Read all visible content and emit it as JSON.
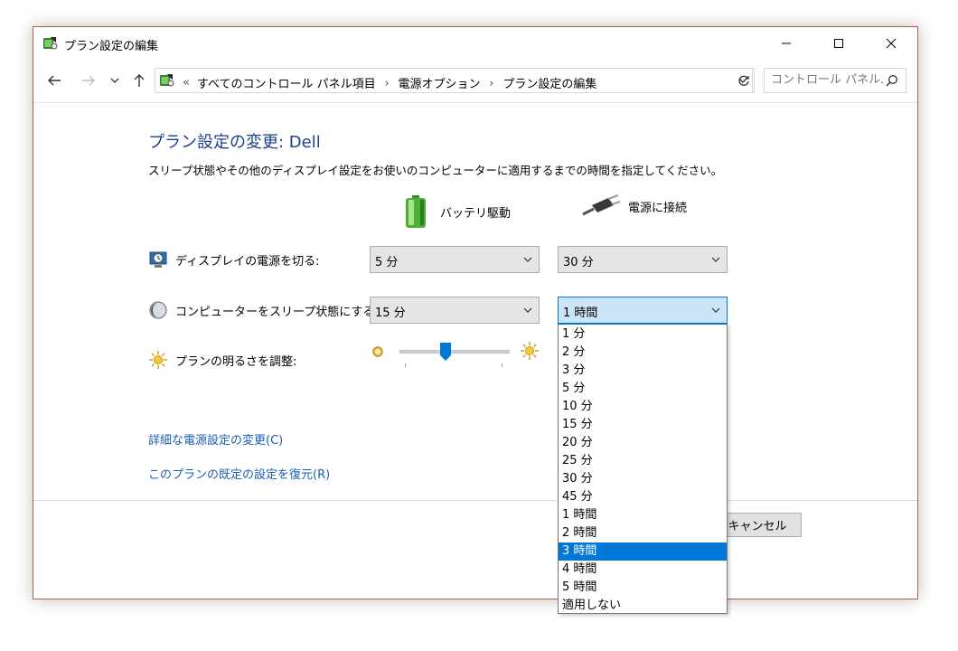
{
  "window": {
    "title": "プラン設定の編集"
  },
  "nav": {
    "crumbs_prefix": "«",
    "crumbs": [
      "すべてのコントロール パネル項目",
      "電源オプション",
      "プラン設定の編集"
    ],
    "crumb_separator": "›",
    "search_placeholder": "コントロール パネル..."
  },
  "content": {
    "heading": "プラン設定の変更: Dell",
    "description": "スリープ状態やその他のディスプレイ設定をお使いのコンピューターに適用するまでの時間を指定してください。",
    "col_battery": "バッテリ駆動",
    "col_ac": "電源に接続",
    "rows": [
      {
        "label": "ディスプレイの電源を切る:",
        "battery": "5 分",
        "ac": "30 分"
      },
      {
        "label": "コンピューターをスリープ状態にする:",
        "battery": "15 分",
        "ac": "1 時間"
      }
    ],
    "brightness_label": "プランの明るさを調整:",
    "brightness_level": 0.42,
    "link_advanced": "詳細な電源設定の変更(C)",
    "link_restore": "このプランの既定の設定を復元(R)",
    "cancel": "キャンセル"
  },
  "dropdown": {
    "options": [
      "1 分",
      "2 分",
      "3 分",
      "5 分",
      "10 分",
      "15 分",
      "20 分",
      "25 分",
      "30 分",
      "45 分",
      "1 時間",
      "2 時間",
      "3 時間",
      "4 時間",
      "5 時間",
      "適用しない"
    ],
    "highlighted": "3 時間"
  },
  "colors": {
    "heading": "#1e3f8c",
    "link": "#1a5fb4",
    "accent": "#0078d7",
    "combo_open_bg": "#cce4f7"
  },
  "icons": {
    "app": "power-plan-icon",
    "back": "back-arrow-icon",
    "forward": "forward-arrow-icon",
    "recent": "chevron-down-icon",
    "up": "up-arrow-icon",
    "refresh": "refresh-icon",
    "search": "search-icon",
    "battery": "battery-icon",
    "plug": "plug-icon",
    "display": "clock-monitor-icon",
    "sleep": "moon-icon",
    "brightness": "sun-icon"
  }
}
